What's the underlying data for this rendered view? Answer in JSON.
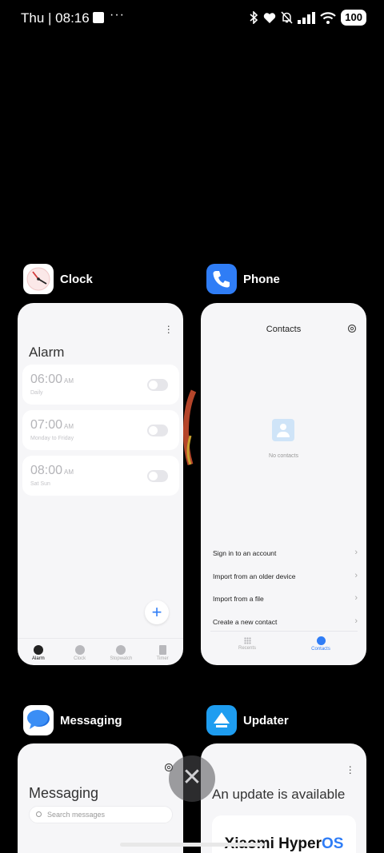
{
  "status_bar": {
    "time": "Thu | 08:16",
    "dots": "···",
    "battery": "100"
  },
  "apps": {
    "clock": {
      "name": "Clock",
      "screen_title": "Alarm",
      "alarms": [
        {
          "time": "06:00",
          "ampm": "AM",
          "repeat": "Daily"
        },
        {
          "time": "07:00",
          "ampm": "AM",
          "repeat": "Monday to Friday"
        },
        {
          "time": "08:00",
          "ampm": "AM",
          "repeat": "Sat Sun"
        }
      ],
      "add_label": "+",
      "tabs": [
        "Alarm",
        "Clock",
        "Stopwatch",
        "Timer"
      ]
    },
    "phone": {
      "name": "Phone",
      "screen_title": "Contacts",
      "empty_text": "No contacts",
      "options": [
        "Sign in to an account",
        "Import from an older device",
        "Import from a file",
        "Create a new contact"
      ],
      "tabs": [
        "Recents",
        "Contacts"
      ]
    },
    "messaging": {
      "name": "Messaging",
      "screen_title": "Messaging",
      "search_placeholder": "Search messages"
    },
    "updater": {
      "name": "Updater",
      "screen_title": "An update is available",
      "brand_part1": "Xiaomi Hyper",
      "brand_part2": "OS"
    }
  },
  "close_label": "✕",
  "colors": {
    "background": "#000000",
    "card": "#f6f6f8",
    "accent": "#2f7df6"
  }
}
